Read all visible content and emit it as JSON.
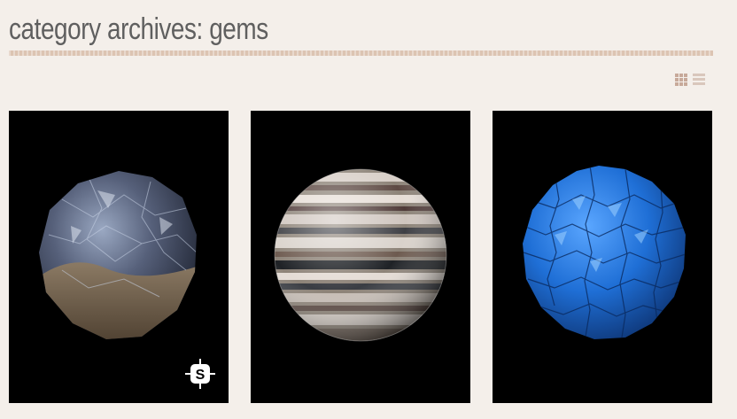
{
  "page": {
    "title": "category archives: gems"
  },
  "view_toggle": {
    "options": [
      {
        "icon": "grid-view-icon",
        "active": true
      },
      {
        "icon": "list-view-icon",
        "active": false
      }
    ]
  },
  "tiles": [
    {
      "image": "rocky-crystal-sphere",
      "badge_icon": "substance-logo-icon"
    },
    {
      "image": "striped-agate-sphere"
    },
    {
      "image": "blue-crystal-sphere"
    }
  ],
  "colors": {
    "background": "#f4efea",
    "title": "#5f5f5f",
    "rule": "#dcc4b2",
    "icon": "#c7a99a",
    "tile_bg": "#000000",
    "crystal_blue": "#1f6fd6"
  }
}
